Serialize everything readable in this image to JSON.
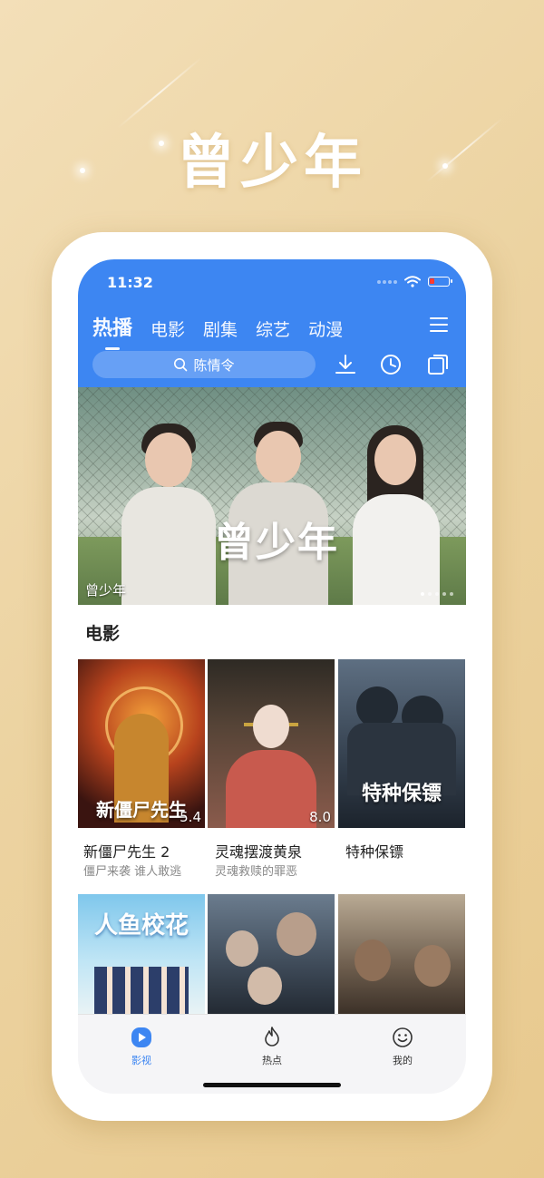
{
  "promo": {
    "title": "曾少年"
  },
  "status_bar": {
    "time": "11:32"
  },
  "top_tabs": [
    {
      "label": "热播",
      "active": true
    },
    {
      "label": "电影",
      "active": false
    },
    {
      "label": "剧集",
      "active": false
    },
    {
      "label": "综艺",
      "active": false
    },
    {
      "label": "动漫",
      "active": false
    }
  ],
  "search": {
    "placeholder": "陈情令"
  },
  "toolbar_icons": [
    "download-icon",
    "history-icon",
    "copy-icon"
  ],
  "banner": {
    "title_art": "曾少年",
    "caption": "曾少年",
    "page_count": 5,
    "active_page": 1
  },
  "movies_section": {
    "title": "电影",
    "items": [
      {
        "name": "新僵尸先生 2",
        "subtitle": "僵尸来袭 谁人敢逃",
        "rating": "5.4",
        "poster_text": "新僵尸先生"
      },
      {
        "name": "灵魂摆渡黄泉",
        "subtitle": "灵魂救赎的罪恶",
        "rating": "8.0",
        "poster_text": ""
      },
      {
        "name": "特种保镖",
        "subtitle": "",
        "rating": "",
        "poster_text": "特种保镖"
      },
      {
        "name": "",
        "subtitle": "",
        "rating": "",
        "poster_text": "人鱼校花"
      },
      {
        "name": "",
        "subtitle": "",
        "rating": "",
        "poster_text": ""
      },
      {
        "name": "",
        "subtitle": "",
        "rating": "",
        "poster_text": ""
      }
    ]
  },
  "bottom_nav": [
    {
      "label": "影视",
      "icon": "play-icon",
      "active": true
    },
    {
      "label": "热点",
      "icon": "flame-icon",
      "active": false
    },
    {
      "label": "我的",
      "icon": "smiley-icon",
      "active": false
    }
  ],
  "colors": {
    "primary": "#3d86f2",
    "background": "#ecd3a1"
  }
}
